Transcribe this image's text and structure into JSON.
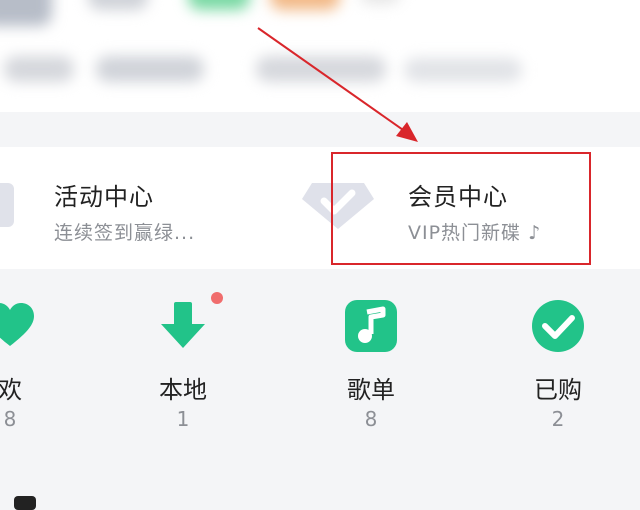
{
  "cards": {
    "activity": {
      "title": "活动中心",
      "subtitle": "连续签到赢绿..."
    },
    "vip": {
      "title": "会员中心",
      "subtitle": "VIP热门新碟 ♪"
    }
  },
  "grid_items": [
    {
      "label": "欢",
      "count": "8",
      "icon": "heart-icon"
    },
    {
      "label": "本地",
      "count": "1",
      "icon": "download-icon"
    },
    {
      "label": "歌单",
      "count": "8",
      "icon": "music-note-icon"
    },
    {
      "label": "已购",
      "count": "2",
      "icon": "check-circle-icon"
    }
  ],
  "colors": {
    "accent_green": "#22c389",
    "highlight_red": "#d9262b",
    "badge_red": "#f06d6d"
  }
}
